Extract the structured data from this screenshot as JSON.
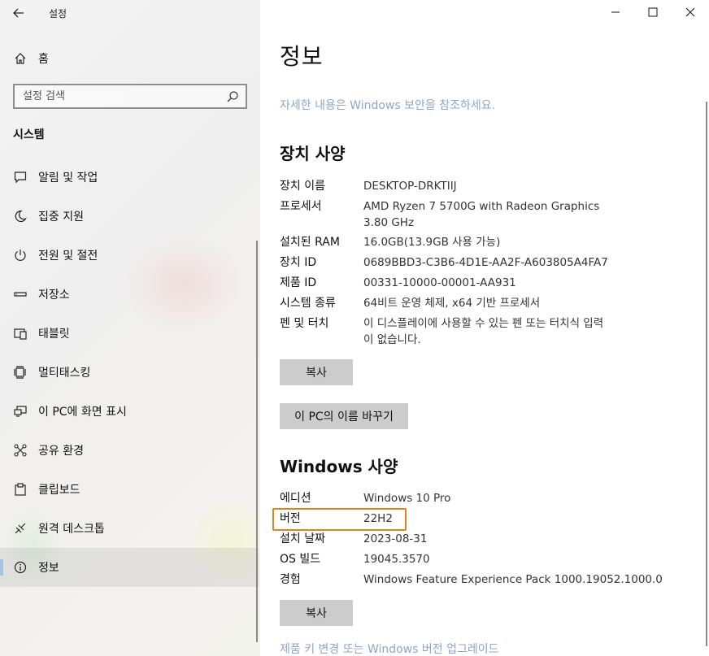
{
  "window": {
    "title": "설정",
    "controls": {
      "minimize": "—",
      "maximize": "☐",
      "close": "✕"
    }
  },
  "sidebar": {
    "home_label": "홈",
    "search_placeholder": "설정 검색",
    "section_title": "시스템",
    "items": [
      {
        "label": "알림 및 작업",
        "icon": "notification-icon"
      },
      {
        "label": "집중 지원",
        "icon": "moon-icon"
      },
      {
        "label": "전원 및 절전",
        "icon": "power-icon"
      },
      {
        "label": "저장소",
        "icon": "storage-icon"
      },
      {
        "label": "태블릿",
        "icon": "tablet-icon"
      },
      {
        "label": "멀티태스킹",
        "icon": "multitasking-icon"
      },
      {
        "label": "이 PC에 화면 표시",
        "icon": "project-icon"
      },
      {
        "label": "공유 환경",
        "icon": "share-icon"
      },
      {
        "label": "클립보드",
        "icon": "clipboard-icon"
      },
      {
        "label": "원격 데스크톱",
        "icon": "remote-icon"
      },
      {
        "label": "정보",
        "icon": "info-icon",
        "active": true
      }
    ]
  },
  "main": {
    "page_title": "정보",
    "security_link": "자세한 내용은 Windows 보안을 참조하세요.",
    "device_specs": {
      "heading": "장치 사양",
      "rows": [
        {
          "key": "장치 이름",
          "value": "DESKTOP-DRKTIIJ"
        },
        {
          "key": "프로세서",
          "value": "AMD Ryzen 7 5700G with Radeon Graphics",
          "value2": "3.80 GHz"
        },
        {
          "key": "설치된 RAM",
          "value": "16.0GB(13.9GB 사용 가능)"
        },
        {
          "key": "장치 ID",
          "value": "0689BBD3-C3B6-4D1E-AA2F-A603805A4FA7"
        },
        {
          "key": "제품 ID",
          "value": "00331-10000-00001-AA931"
        },
        {
          "key": "시스템 종류",
          "value": "64비트 운영 체제, x64 기반 프로세서"
        },
        {
          "key": "펜 및 터치",
          "value": "이 디스플레이에 사용할 수 있는 펜 또는 터치식 입력",
          "value2": "이 없습니다."
        }
      ],
      "copy_button": "복사",
      "rename_button": "이 PC의 이름 바꾸기"
    },
    "windows_specs": {
      "heading": "Windows 사양",
      "rows": [
        {
          "key": "에디션",
          "value": "Windows 10 Pro"
        },
        {
          "key": "버전",
          "value": "22H2"
        },
        {
          "key": "설치 날짜",
          "value": "2023-08-31"
        },
        {
          "key": "OS 빌드",
          "value": "19045.3570"
        },
        {
          "key": "경험",
          "value": "Windows Feature Experience Pack 1000.19052.1000.0"
        }
      ],
      "copy_button": "복사",
      "upgrade_link": "제품 키 변경 또는 Windows 버전 업그레이드"
    },
    "highlight_color": "#e67e22"
  }
}
